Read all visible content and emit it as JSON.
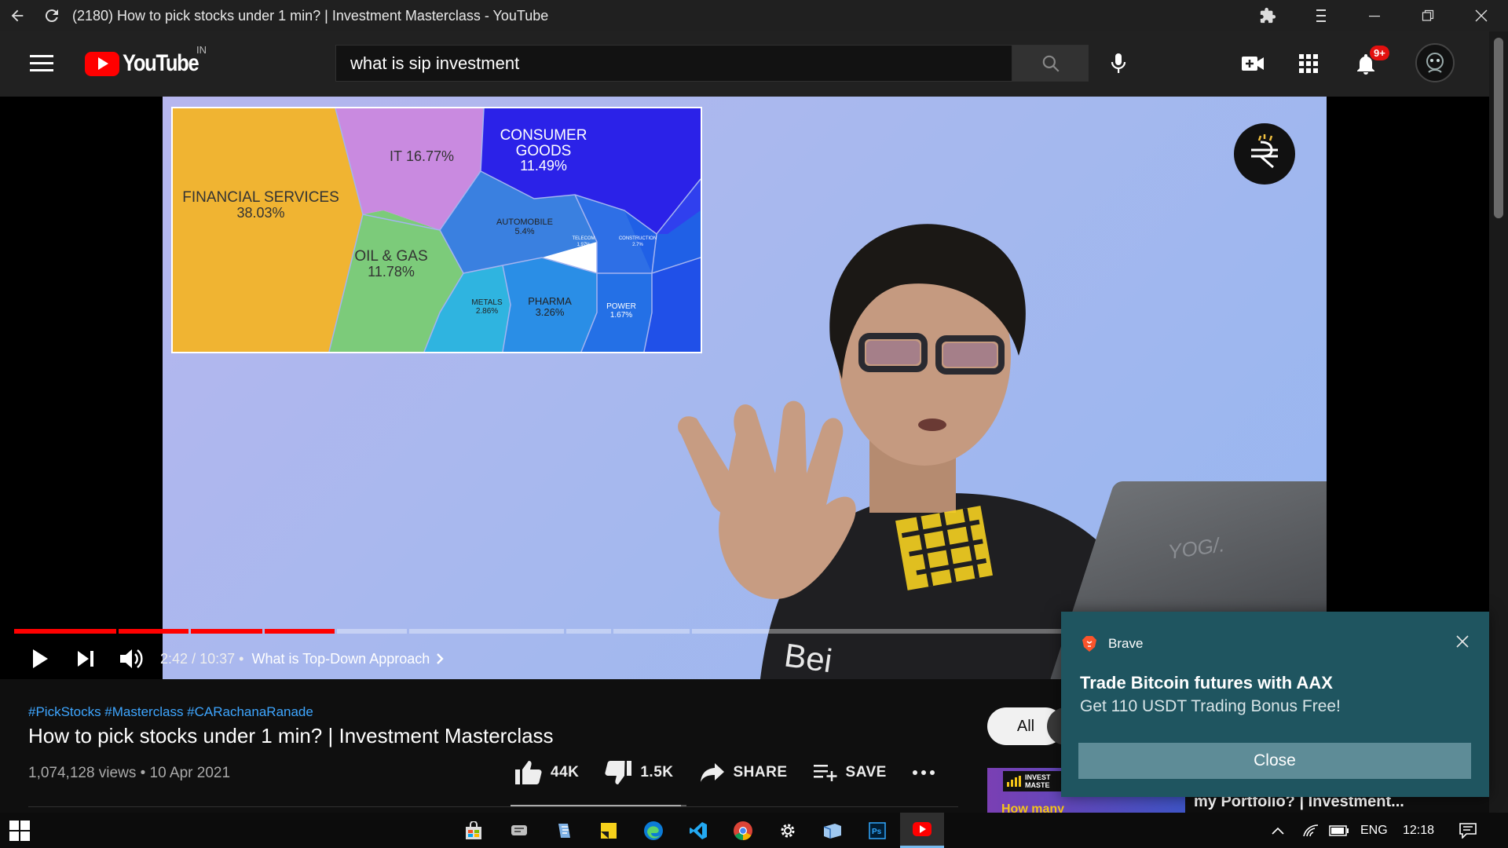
{
  "window": {
    "title": "(2180) How to pick stocks under 1 min? | Investment Masterclass - YouTube"
  },
  "masthead": {
    "logo_text": "YouTube",
    "country_code": "IN",
    "search_value": "what is sip investment",
    "notification_count": "9+"
  },
  "video": {
    "treemap": [
      {
        "label": "FINANCIAL SERVICES",
        "value": "38.03%"
      },
      {
        "label": "IT",
        "value": "16.77%"
      },
      {
        "label": "CONSUMER GOODS",
        "value": "11.49%"
      },
      {
        "label": "OIL & GAS",
        "value": "11.78%"
      },
      {
        "label": "AUTOMOBILE",
        "value": "5.4%"
      },
      {
        "label": "TELECOM",
        "value": "1.97%"
      },
      {
        "label": "CONSTRUCTION",
        "value": "2.7%"
      },
      {
        "label": "METALS",
        "value": "2.86%"
      },
      {
        "label": "PHARMA",
        "value": "3.26%"
      },
      {
        "label": "POWER",
        "value": "1.67%"
      }
    ],
    "shirt_text": "Bei",
    "laptop_text": "YOG/.",
    "progress_fraction": 0.26
  },
  "controls": {
    "current_time": "2:42",
    "duration": "10:37",
    "separator": "/",
    "bullet": "•",
    "chapter": "What is Top-Down Approach"
  },
  "details": {
    "hashtags": "#PickStocks #Masterclass #CARachanaRanade",
    "title": "How to pick stocks under 1 min? | Investment Masterclass",
    "views": "1,074,128 views",
    "date": "10 Apr 2021",
    "meta_separator": "•",
    "likes": "44K",
    "dislikes": "1.5K",
    "share_label": "SHARE",
    "save_label": "SAVE"
  },
  "sidebar": {
    "chip_all": "All",
    "rec_thumb_text_1": "INVEST",
    "rec_thumb_text_2": "MASTE",
    "rec_thumb_bottom": "How many",
    "rec_title": "my Portfolio? | Investment..."
  },
  "notification": {
    "app": "Brave",
    "title": "Trade Bitcoin futures with AAX",
    "body": "Get 110 USDT Trading Bonus Free!",
    "close_label": "Close"
  },
  "taskbar": {
    "language": "ENG",
    "time": "12:18"
  },
  "colors": {
    "accent_red": "#ff0000",
    "link_blue": "#3ea6ff",
    "toast_bg": "#1f5560"
  }
}
